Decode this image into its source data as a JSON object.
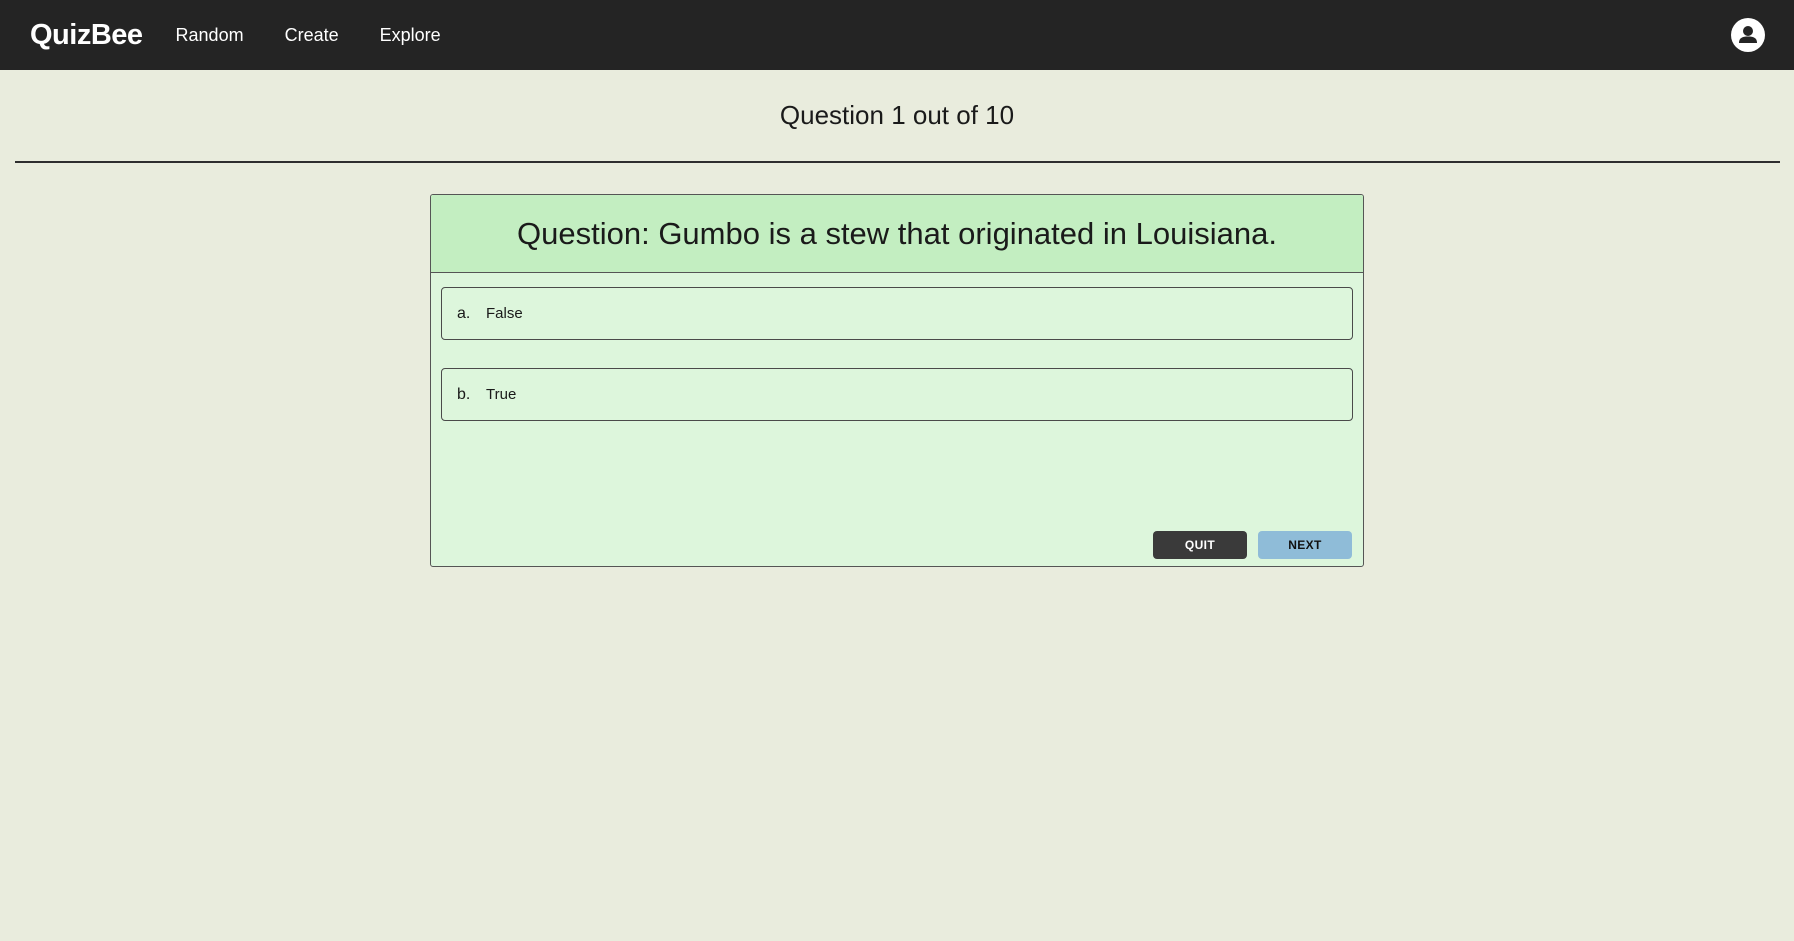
{
  "navbar": {
    "brand": "QuizBee",
    "links": [
      "Random",
      "Create",
      "Explore"
    ]
  },
  "quiz": {
    "progress": "Question 1 out of 10",
    "question": "Question: Gumbo is a stew that originated in Louisiana.",
    "options": [
      {
        "letter": "a.",
        "text": "False"
      },
      {
        "letter": "b.",
        "text": "True"
      }
    ],
    "quit_label": "QUIT",
    "next_label": "NEXT"
  },
  "colors": {
    "navbar_bg": "#242424",
    "page_bg": "#e9ecdd",
    "card_header_bg": "#c3eec1",
    "card_bg": "#ddf6dc",
    "quit_bg": "#3a3a3a",
    "next_bg": "#8fbcd8"
  },
  "icons": {
    "account": "user-circle-icon"
  }
}
